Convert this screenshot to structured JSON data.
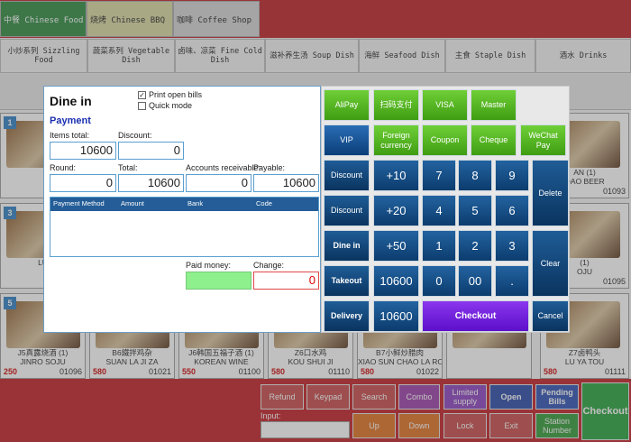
{
  "top_tabs": [
    {
      "label": "中餐 Chinese Food",
      "bg": "#2c8a3e",
      "fg": "#ffffff"
    },
    {
      "label": "烧烤 Chinese BBQ",
      "bg": "#d9d9a0",
      "fg": "#222222"
    },
    {
      "label": "咖啡 Coffee Shop",
      "bg": "#d4d4d4",
      "fg": "#222222"
    }
  ],
  "categories": [
    {
      "label": "小炒系列 Sizzling Food"
    },
    {
      "label": "蔬菜系列 Vegetable Dish"
    },
    {
      "label": "卤味、凉菜 Fine Cold Dish"
    },
    {
      "label": "滋补养生汤 Soup Dish"
    },
    {
      "label": "海鲜 Seafood Dish"
    },
    {
      "label": "主食 Staple Dish"
    },
    {
      "label": "酒水 Drinks"
    }
  ],
  "menu_items": [
    {
      "badge": "1",
      "name": "",
      "price": "",
      "code": "01"
    },
    {
      "badge": "",
      "name": "",
      "price": "",
      "code": ""
    },
    {
      "badge": "",
      "name": "",
      "price": "",
      "code": ""
    },
    {
      "badge": "",
      "name": "",
      "price": "",
      "code": ""
    },
    {
      "badge": "",
      "name": "",
      "price": "",
      "code": ""
    },
    {
      "badge": "",
      "name": "",
      "price": "",
      "code": ""
    },
    {
      "badge": "",
      "name": "AN (1)\nOAO BEER",
      "price": "",
      "code": "01093"
    },
    {
      "badge": "3",
      "name": "LU",
      "price": "",
      "code": "01"
    },
    {
      "badge": "",
      "name": "",
      "price": "",
      "code": ""
    },
    {
      "badge": "",
      "name": "",
      "price": "",
      "code": ""
    },
    {
      "badge": "",
      "name": "",
      "price": "",
      "code": ""
    },
    {
      "badge": "",
      "name": "",
      "price": "",
      "code": ""
    },
    {
      "badge": "",
      "name": "",
      "price": "",
      "code": ""
    },
    {
      "badge": "",
      "name": "(1)\nOJU",
      "price": "",
      "code": "01095"
    },
    {
      "badge": "5",
      "name": "J5真露烧酒 (1)\nJINRO SOJU",
      "price": "250",
      "code": "01096"
    },
    {
      "badge": "",
      "name": "B6鐵拌鸡杂\nSUAN LA JI ZA",
      "price": "580",
      "code": "01021"
    },
    {
      "badge": "",
      "name": "J6韩国五福子酒 (1)\nKOREAN WINE",
      "price": "550",
      "code": "01100"
    },
    {
      "badge": "",
      "name": "Z6口水鸡\nKOU SHUI JI",
      "price": "580",
      "code": "01110"
    },
    {
      "badge": "",
      "name": "B7小鲜炒腊肉\nXIAO SUN CHAO LA ROU",
      "price": "580",
      "code": "01022"
    },
    {
      "badge": "",
      "name": "",
      "price": "",
      "code": ""
    },
    {
      "badge": "",
      "name": "Z7卤鸭头\nLU YA TOU",
      "price": "580",
      "code": "01111"
    }
  ],
  "bottom_buttons": [
    {
      "label": "Refund",
      "bg": "#c84848"
    },
    {
      "label": "Keypad",
      "bg": "#c84848"
    },
    {
      "label": "Search",
      "bg": "#c84848"
    },
    {
      "label": "Combo",
      "bg": "#9c3da8"
    },
    {
      "label": "Limited supply",
      "bg": "#8b3fbf"
    },
    {
      "label": "Open",
      "bg": "#2747a8"
    },
    {
      "label": "Pending Bills",
      "bg": "#2c4fb3"
    },
    {
      "label": "Checkout",
      "bg": "#25a23a"
    },
    {
      "label": "Up",
      "bg": "#e0701f"
    },
    {
      "label": "Down",
      "bg": "#e0701f"
    },
    {
      "label": "Lock",
      "bg": "#c84848"
    },
    {
      "label": "Exit",
      "bg": "#c84848"
    },
    {
      "label": "Station Number",
      "bg": "#2f9a35"
    }
  ],
  "input_label": "Input:",
  "dialog": {
    "title": "Dine in",
    "print_open_bills": {
      "label": "Print open bills",
      "checked": true
    },
    "quick_mode": {
      "label": "Quick mode",
      "checked": false
    },
    "section": "Payment",
    "items_total_label": "Items total:",
    "items_total": "10600",
    "discount_label": "Discount:",
    "discount": "0",
    "round_label": "Round:",
    "round": "0",
    "total_label": "Total:",
    "total": "10600",
    "accounts_receivable_label": "Accounts receivable:",
    "accounts_receivable": "0",
    "payable_label": "Payable:",
    "payable": "10600",
    "table_headers": [
      "Payment Method",
      "Amount",
      "Bank",
      "Code"
    ],
    "paid_money_label": "Paid money:",
    "paid_money": "",
    "change_label": "Change:",
    "change": "0"
  },
  "keypad": {
    "pay_methods": [
      "AliPay",
      "扫码支付",
      "VISA",
      "Master"
    ],
    "pay_methods2": [
      "VIP",
      "Foreign currency",
      "Coupon",
      "Cheque",
      "WeChat Pay"
    ],
    "discount1": "Discount",
    "discount2": "Discount",
    "dine_in": "Dine in",
    "takeout": "Takeout",
    "delivery": "Delivery",
    "add10": "+10",
    "add20": "+20",
    "add50": "+50",
    "amount1": "10600",
    "amount2": "10600",
    "digits": [
      "7",
      "8",
      "9",
      "4",
      "5",
      "6",
      "1",
      "2",
      "3"
    ],
    "zero": "0",
    "double_zero": "00",
    "dot": ".",
    "delete": "Delete",
    "clear": "Clear",
    "cancel": "Cancel",
    "checkout": "Checkout"
  }
}
